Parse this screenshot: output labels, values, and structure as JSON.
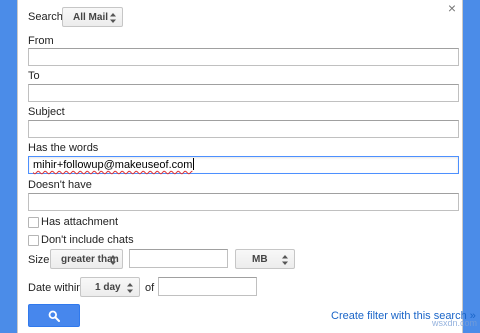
{
  "search": {
    "label": "Search",
    "scope_value": "All Mail"
  },
  "fields": {
    "from": {
      "label": "From",
      "value": ""
    },
    "to": {
      "label": "To",
      "value": ""
    },
    "subject": {
      "label": "Subject",
      "value": ""
    },
    "has_words": {
      "label": "Has the words",
      "value": "mihir+followup@makeuseof.com"
    },
    "doesnt_have": {
      "label": "Doesn't have",
      "value": ""
    }
  },
  "checkboxes": {
    "has_attachment": {
      "label": "Has attachment",
      "checked": false
    },
    "dont_include_chats": {
      "label": "Don't include chats",
      "checked": false
    }
  },
  "size": {
    "label": "Size",
    "operator": "greater than",
    "value": "",
    "unit": "MB"
  },
  "date": {
    "label": "Date within",
    "range": "1 day",
    "of_label": "of",
    "value": ""
  },
  "actions": {
    "create_filter_label": "Create filter with this search »"
  },
  "close": {
    "glyph": "×"
  },
  "colors": {
    "backdrop": "#4b8ce8",
    "search_button": "#4787ed",
    "link": "#1a65c8",
    "focus_border": "#4d90fe"
  },
  "icons": {
    "close": "close-icon",
    "search": "search-icon",
    "select_arrows": "updown-arrows-icon"
  },
  "watermark": "wsxdn.com"
}
